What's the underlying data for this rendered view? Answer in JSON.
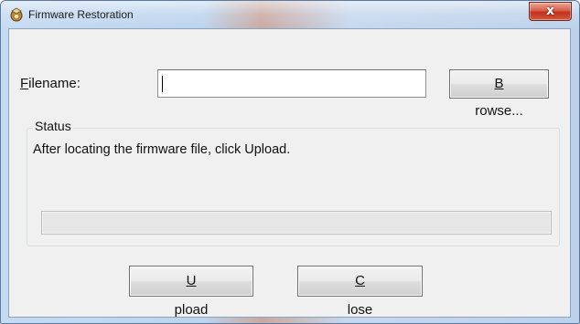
{
  "window": {
    "title": "Firmware Restoration",
    "close_label": "x"
  },
  "form": {
    "filename_label_accel": "F",
    "filename_label_rest": "ilename:",
    "filename_value": "",
    "browse_label_accel": "B",
    "browse_label_rest": "rowse..."
  },
  "status": {
    "group_title": "Status",
    "message": "After locating the firmware file, click Upload.",
    "progress": 0
  },
  "buttons": {
    "upload_accel": "U",
    "upload_rest": "pload",
    "close_accel": "C",
    "close_rest": "lose"
  },
  "icons": {
    "app": "firmware-restoration-icon",
    "close": "close-icon"
  }
}
